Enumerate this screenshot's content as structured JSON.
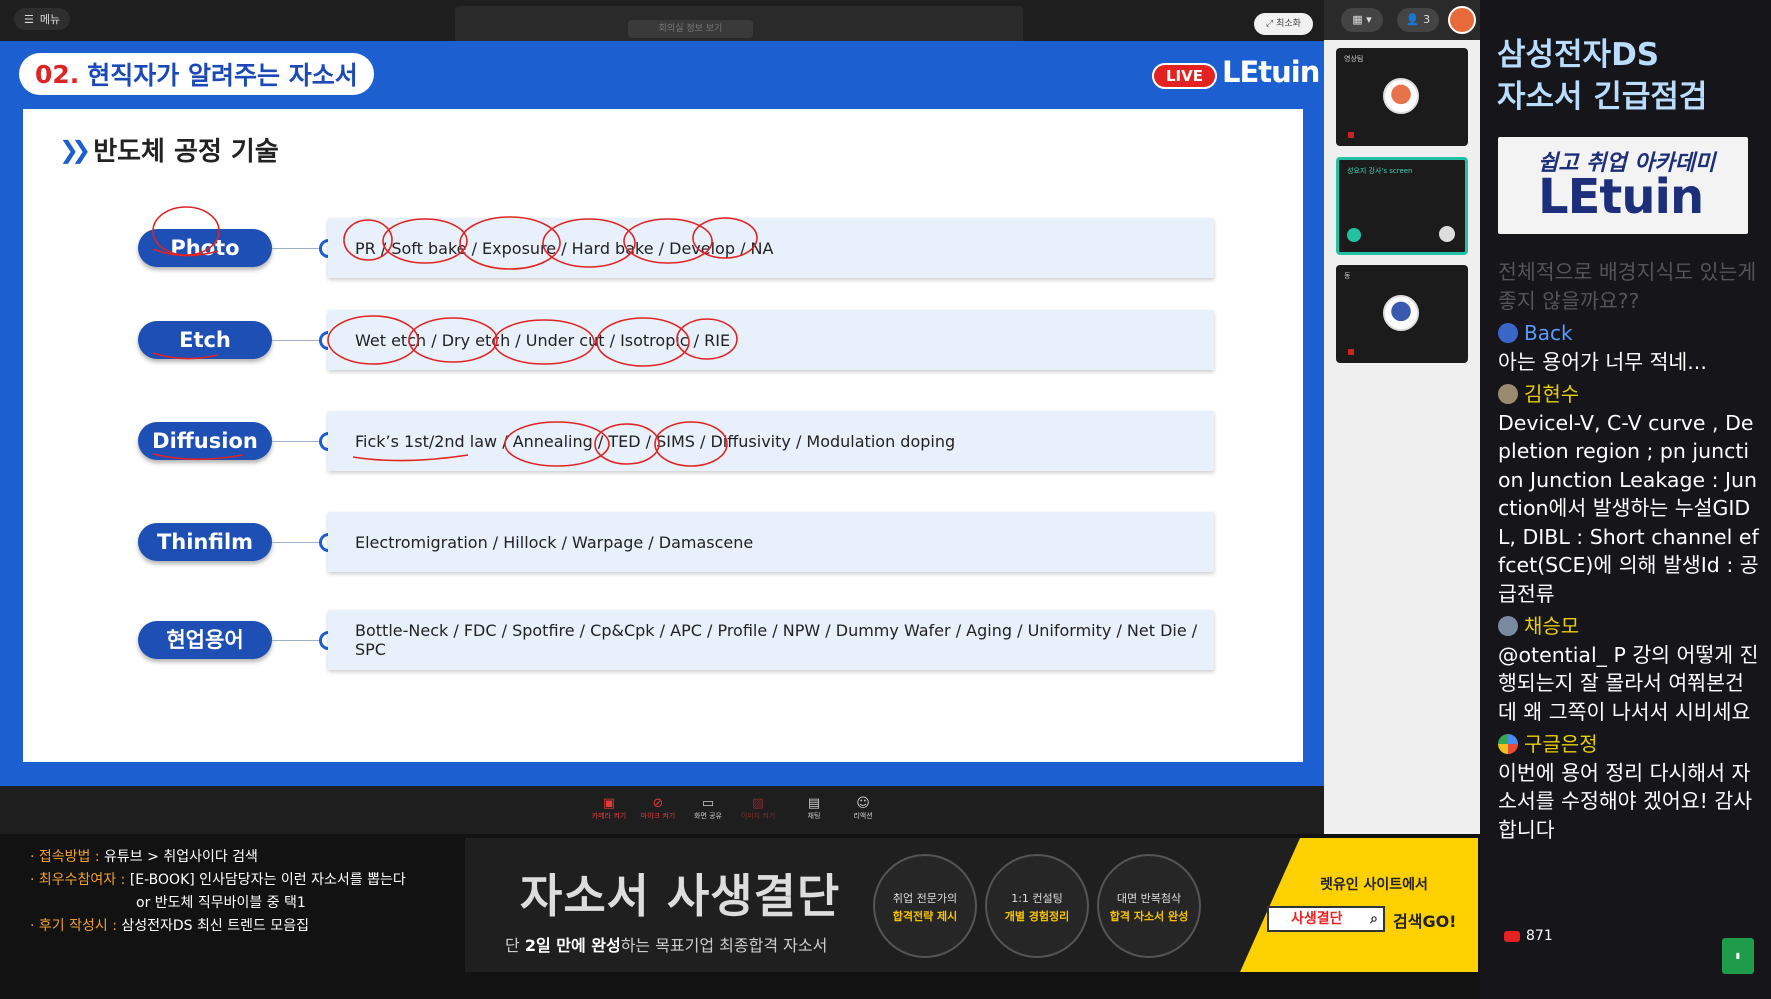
{
  "topbar": {
    "menu_label": "메뉴",
    "center_label": "회의실 정보 보기",
    "minimize_label": "최소화"
  },
  "slide": {
    "title_num": "02.",
    "title_text": "현직자가 알려주는 자소서",
    "live_label": "LIVE",
    "brand": "LEtuin",
    "section_title": "반도체 공정 기술",
    "rows": [
      {
        "label": "Photo",
        "terms": "PR / Soft bake / Exposure / Hard bake / Develop / NA"
      },
      {
        "label": "Etch",
        "terms": "Wet etch / Dry etch / Under cut / Isotropic / RIE"
      },
      {
        "label": "Diffusion",
        "terms": "Fick’s 1st/2nd law  / Annealing / TED / SIMS / Diffusivity / Modulation doping"
      },
      {
        "label": "Thinfilm",
        "terms": "Electromigration / Hillock / Warpage / Damascene"
      },
      {
        "label": "현업용어",
        "terms": "Bottle-Neck / FDC / Spotfire / Cp&Cpk / APC / Profile / NPW / Dummy Wafer / Aging / Uniformity / Net Die / SPC"
      }
    ]
  },
  "toolbar": {
    "items": [
      {
        "label": "카메라 켜기",
        "icon": "camera-off-icon"
      },
      {
        "label": "마이크 켜기",
        "icon": "mic-off-icon"
      },
      {
        "label": "화면 공유",
        "icon": "screen-share-icon"
      },
      {
        "label": "이미지 켜기",
        "icon": "image-icon"
      },
      {
        "label": "채팅",
        "icon": "chat-icon"
      },
      {
        "label": "리액션",
        "icon": "reaction-icon"
      }
    ]
  },
  "footer": {
    "line1_label": "· 접속방법 : ",
    "line1_value": "유튜브 > 취업사이다 검색",
    "line2_label": "· 최우수참여자 : ",
    "line2_value": "[E-BOOK] 인사담당자는 이런 자소서를 뽑는다",
    "line3_value": "or 반도체 직무바이블 중 택1",
    "line4_label": "· 후기 작성시 : ",
    "line4_value": "삼성전자DS 최신 트렌드 모음집"
  },
  "banner": {
    "title": "자소서 사생결단",
    "sub_prefix": "단 ",
    "sub_bold": "2일 만에 완성",
    "sub_suffix": "하는 목표기업 최종합격 자소서",
    "circles": [
      {
        "top": "취업 전문가의",
        "bottom": "합격전략 제시"
      },
      {
        "top": "1:1 컨설팅",
        "bottom": "개별 경험정리"
      },
      {
        "top": "대면 반복첨삭",
        "bottom": "합격 자소서 완성"
      }
    ],
    "cta_title": "렛유인 사이트에서",
    "cta_search": "사생결단",
    "cta_go": "검색GO!"
  },
  "video": {
    "user_count": "3",
    "tiles": [
      {
        "label": "영상팀"
      },
      {
        "label": "성요지 강사's screen"
      },
      {
        "label": "동"
      }
    ]
  },
  "side": {
    "title_line1": "삼성전자DS",
    "title_line2": "자소서 긴급점검",
    "logo_top": "쉽고 취업 아카데미",
    "logo_brand": "LEtuin",
    "chat": {
      "faded": "전체적으로 배경지식도 있는게 좋지 않을까요??",
      "messages": [
        {
          "name": "Back",
          "text": "아는 용어가 너무 적네..."
        },
        {
          "name": "김현수",
          "text": "Devicel-V, C-V curve , Depletion region ; pn junction Junction Leakage : Junction에서 발생하는 누설GIDL, DIBL : Short channel effcet(SCE)에 의해 발생Id : 공급전류"
        },
        {
          "name": "채승모",
          "text": "@otential_ P 강의 어떻게 진행되는지 잘 몰라서 여쭤본건데 왜 그쪽이 나서서 시비세요"
        },
        {
          "name": "구글은정",
          "text": "이번에 용어 정리 다시해서 자소서를 수정해야 겠어요! 감사합니다"
        }
      ]
    },
    "viewer_count": "871"
  }
}
